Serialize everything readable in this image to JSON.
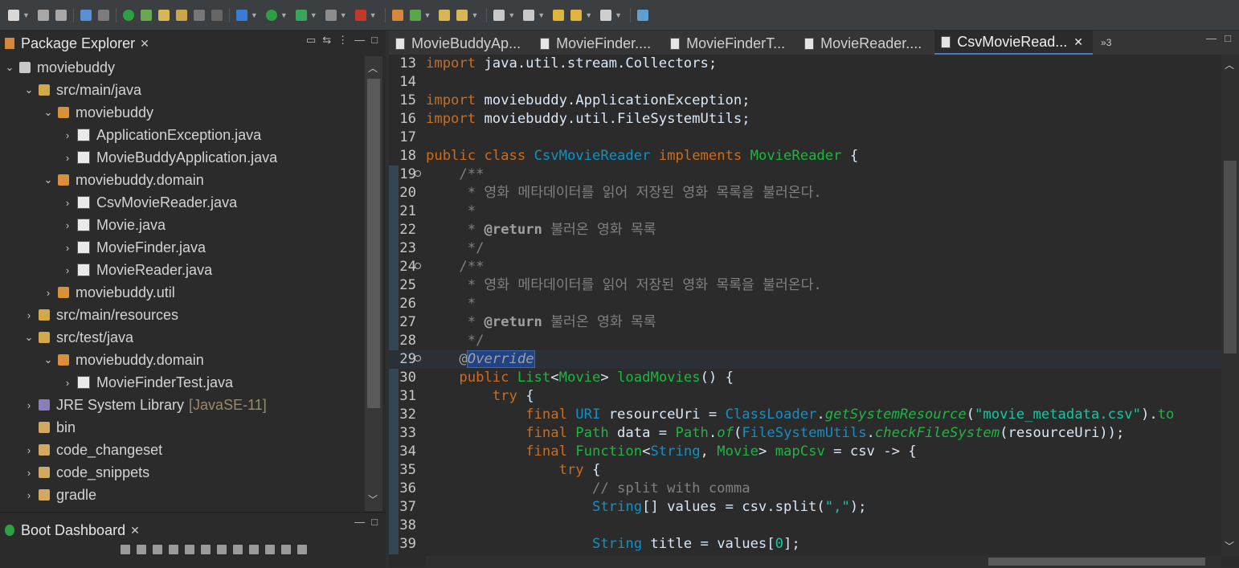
{
  "toolbar": {
    "icons": [
      "new-icon",
      "save-icon",
      "save-all-icon",
      "debug-icon",
      "run-icon",
      "search-icon",
      "back-icon",
      "forward-icon"
    ]
  },
  "package_explorer": {
    "title": "Package Explorer",
    "close": "✕",
    "tree": [
      {
        "label": "moviebuddy",
        "chev": "⌄",
        "icon": "proj"
      },
      {
        "label": "src/main/java",
        "chev": "⌄",
        "icon": "src"
      },
      {
        "label": "moviebuddy",
        "chev": "⌄",
        "icon": "pkg"
      },
      {
        "label": "ApplicationException.java",
        "chev": "›",
        "icon": "java"
      },
      {
        "label": "MovieBuddyApplication.java",
        "chev": "›",
        "icon": "java"
      },
      {
        "label": "moviebuddy.domain",
        "chev": "⌄",
        "icon": "pkg"
      },
      {
        "label": "CsvMovieReader.java",
        "chev": "›",
        "icon": "java"
      },
      {
        "label": "Movie.java",
        "chev": "›",
        "icon": "java"
      },
      {
        "label": "MovieFinder.java",
        "chev": "›",
        "icon": "java"
      },
      {
        "label": "MovieReader.java",
        "chev": "›",
        "icon": "java"
      },
      {
        "label": "moviebuddy.util",
        "chev": "›",
        "icon": "pkg"
      },
      {
        "label": "src/main/resources",
        "chev": "›",
        "icon": "src"
      },
      {
        "label": "src/test/java",
        "chev": "⌄",
        "icon": "src"
      },
      {
        "label": "moviebuddy.domain",
        "chev": "⌄",
        "icon": "pkg"
      },
      {
        "label": "MovieFinderTest.java",
        "chev": "›",
        "icon": "java"
      },
      {
        "label": "JRE System Library",
        "suffix": "[JavaSE-11]",
        "chev": "›",
        "icon": "lib"
      },
      {
        "label": "bin",
        "chev": "",
        "icon": "folder"
      },
      {
        "label": "code_changeset",
        "chev": "›",
        "icon": "folder"
      },
      {
        "label": "code_snippets",
        "chev": "›",
        "icon": "folder"
      },
      {
        "label": "gradle",
        "chev": "›",
        "icon": "folder"
      }
    ]
  },
  "boot_dashboard": {
    "title": "Boot Dashboard",
    "close": "✕"
  },
  "editor": {
    "tabs": [
      {
        "label": "MovieBuddyAp...",
        "active": false
      },
      {
        "label": "MovieFinder....",
        "active": false
      },
      {
        "label": "MovieFinderT...",
        "active": false
      },
      {
        "label": "MovieReader....",
        "active": false
      },
      {
        "label": "CsvMovieRead...",
        "active": true
      }
    ],
    "overflow": "»3",
    "close": "✕",
    "lines": [
      {
        "n": "13",
        "html": "<span class='kw'>import</span> java.util.stream.Collectors;"
      },
      {
        "n": "14",
        "html": ""
      },
      {
        "n": "15",
        "html": "<span class='kw'>import</span> moviebuddy.ApplicationException;"
      },
      {
        "n": "16",
        "html": "<span class='kw'>import</span> moviebuddy.util.FileSystemUtils;"
      },
      {
        "n": "17",
        "html": ""
      },
      {
        "n": "18",
        "html": "<span class='kw'>public</span> <span class='kw'>class</span> <span class='ty'>CsvMovieReader</span> <span class='kw'>implements</span> <span class='cls'>MovieReader</span> {"
      },
      {
        "n": "19",
        "fold": true,
        "html": "    <span class='cm'>/**</span>"
      },
      {
        "n": "20",
        "html": "<span class='cm'>     * 영화 메타데이터를 읽어 저장된 영화 목록을 불러온다.</span>"
      },
      {
        "n": "21",
        "html": "<span class='cm'>     *</span>"
      },
      {
        "n": "22",
        "html": "<span class='cm'>     * </span><span class='cmk'>@return</span><span class='cm'> 불러온 영화 목록</span>"
      },
      {
        "n": "23",
        "html": "<span class='cm'>     */</span>"
      },
      {
        "n": "24",
        "fold": true,
        "html": "    <span class='cm'>/**</span>"
      },
      {
        "n": "25",
        "html": "<span class='cm'>     * 영화 메타데이터를 읽어 저장된 영화 목록을 불러온다.</span>"
      },
      {
        "n": "26",
        "html": "<span class='cm'>     *</span>"
      },
      {
        "n": "27",
        "html": "<span class='cm'>     * </span><span class='cmk'>@return</span><span class='cm'> 불러온 영화 목록</span>"
      },
      {
        "n": "28",
        "html": "<span class='cm'>     */</span>"
      },
      {
        "n": "29",
        "fold": true,
        "hl": true,
        "html": "    <span class='ann'>@</span><span class='ann it sel'>Override</span>"
      },
      {
        "n": "30",
        "html": "    <span class='kw'>public</span> <span class='cls'>List</span>&lt;<span class='cls'>Movie</span>&gt; <span class='meth'>loadMovies</span>() {"
      },
      {
        "n": "31",
        "html": "        <span class='kw'>try</span> {"
      },
      {
        "n": "32",
        "html": "            <span class='kw'>final</span> <span class='ty'>URI</span> resourceUri = <span class='ty'>ClassLoader</span>.<span class='meth it'>getSystemResource</span>(<span class='str'>\"movie_metadata.csv\"</span>).<span class='meth'>to</span>"
      },
      {
        "n": "33",
        "html": "            <span class='kw'>final</span> <span class='cls'>Path</span> data = <span class='cls'>Path</span>.<span class='meth it'>of</span>(<span class='ty'>FileSystemUtils</span>.<span class='meth it'>checkFileSystem</span>(resourceUri));"
      },
      {
        "n": "34",
        "html": "            <span class='kw'>final</span> <span class='cls'>Function</span>&lt;<span class='ty'>String</span>, <span class='cls'>Movie</span>&gt; <span class='meth'>mapCsv</span> = csv -&gt; {"
      },
      {
        "n": "35",
        "html": "                <span class='kw'>try</span> {"
      },
      {
        "n": "36",
        "html": "                    <span class='cm'>// split with comma</span>"
      },
      {
        "n": "37",
        "html": "                    <span class='ty'>String</span>[] values = csv.split(<span class='str'>\",\"</span>);"
      },
      {
        "n": "38",
        "html": ""
      },
      {
        "n": "39",
        "html": "                    <span class='ty'>String</span> title = values[<span class='str'>0</span>];"
      }
    ]
  }
}
